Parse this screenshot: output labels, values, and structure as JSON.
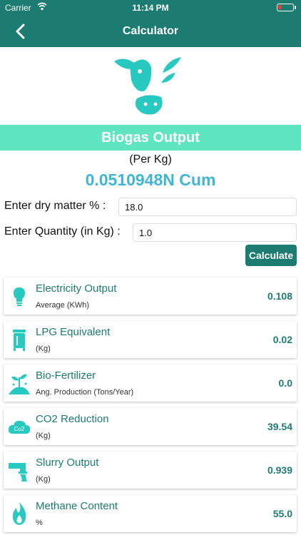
{
  "status": {
    "carrier": "Carrier",
    "time": "11:14 PM"
  },
  "nav": {
    "title": "Calculator"
  },
  "banner": {
    "title": "Biogas Output",
    "per": "(Per Kg)",
    "result": "0.0510948N Cum"
  },
  "form": {
    "dry_matter_label": "Enter dry matter % :",
    "dry_matter_value": "18.0",
    "quantity_label": "Enter Quantity (in Kg) :",
    "quantity_value": "1.0",
    "calculate_label": "Calculate"
  },
  "cards": [
    {
      "title": "Electricity Output",
      "sub": "Average (KWh)",
      "value": "0.108",
      "icon": "bulb-icon"
    },
    {
      "title": "LPG Equivalent",
      "sub": "(Kg)",
      "value": "0.02",
      "icon": "gas-cylinder-icon"
    },
    {
      "title": "Bio-Fertilizer",
      "sub": "Ang. Production (Tons/Year)",
      "value": "0.0",
      "icon": "plant-icon"
    },
    {
      "title": "CO2 Reduction",
      "sub": "(Kg)",
      "value": "39.54",
      "icon": "co2-cloud-icon"
    },
    {
      "title": "Slurry Output",
      "sub": "(Kg)",
      "value": "0.939",
      "icon": "pipe-icon"
    },
    {
      "title": "Methane Content",
      "sub": "%",
      "value": "55.0",
      "icon": "flame-icon"
    }
  ],
  "colors": {
    "primary": "#1c7c72",
    "accent": "#5fe6c0",
    "icon": "#27c9c0",
    "result": "#3fb6d3"
  }
}
